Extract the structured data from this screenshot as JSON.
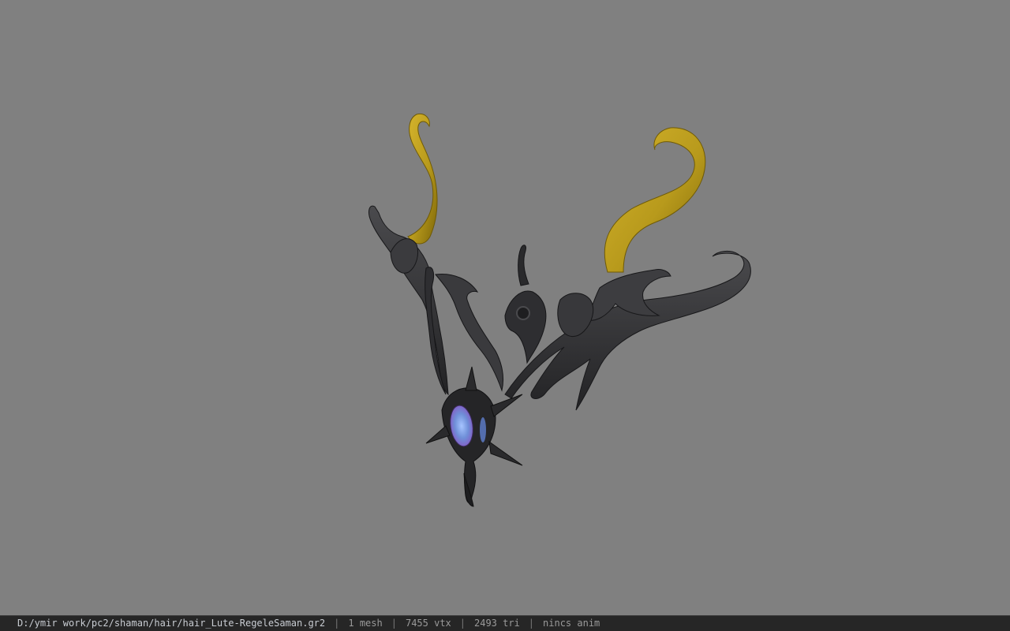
{
  "viewer": {
    "background_color": "#808080",
    "model_colors": {
      "dark_metal": "#3a3a3c",
      "dark_metal_shadow": "#1e1e20",
      "gold": "#b89a1c",
      "gold_shadow": "#7d6608",
      "gem_core": "#6f8fd8",
      "gem_glow": "#b07ad6"
    }
  },
  "status": {
    "file_path": "D:/ymir work/pc2/shaman/hair/hair_Lute-RegeleSaman.gr2",
    "separator": "|",
    "mesh": "1 mesh",
    "vertices": "7455 vtx",
    "triangles": "2493 tri",
    "animation": "nincs anim"
  }
}
